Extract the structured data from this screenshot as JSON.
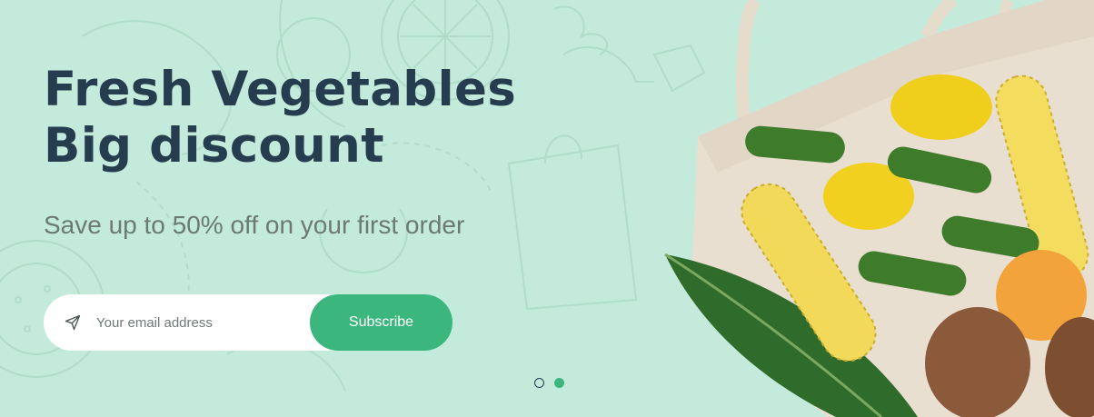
{
  "hero": {
    "title_line1": "Fresh Vegetables",
    "title_line2": "Big discount",
    "subtitle": "Save up to 50% off on your first order"
  },
  "subscribe_form": {
    "placeholder": "Your email address",
    "button_label": "Subscribe",
    "icon": "send-icon"
  },
  "slider": {
    "total_slides": 2,
    "active_slide": 2
  },
  "colors": {
    "background": "#c3eada",
    "heading": "#253d4e",
    "subtitle": "#6b7a75",
    "accent": "#3bb77e"
  },
  "image": {
    "description_icon": "vegetables-bag-image"
  }
}
